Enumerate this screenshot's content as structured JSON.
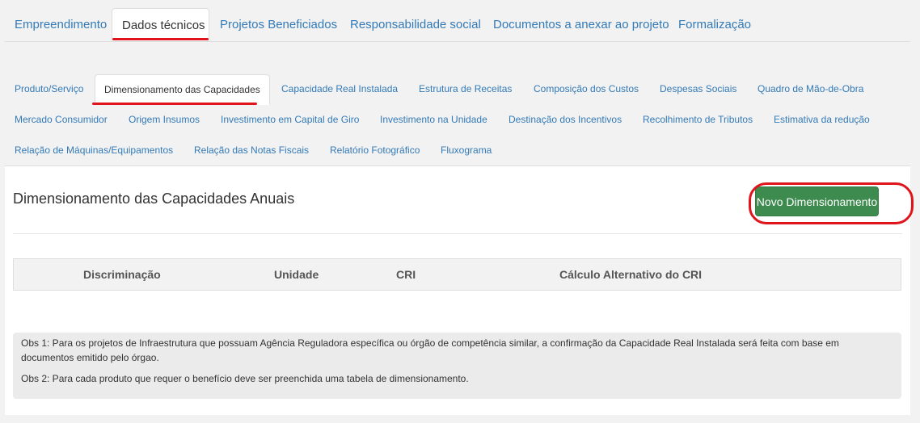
{
  "top_tabs": [
    {
      "label": "Empreendimento"
    },
    {
      "label": "Dados técnicos"
    },
    {
      "label": "Projetos Beneficiados"
    },
    {
      "label": "Responsabilidade social"
    },
    {
      "label": "Documentos a anexar ao projeto"
    },
    {
      "label": "Formalização"
    }
  ],
  "sub_tabs": [
    {
      "label": "Produto/Serviço"
    },
    {
      "label": "Dimensionamento das Capacidades"
    },
    {
      "label": "Capacidade Real Instalada"
    },
    {
      "label": "Estrutura de Receitas"
    },
    {
      "label": "Composição dos Custos"
    },
    {
      "label": "Despesas Sociais"
    },
    {
      "label": "Quadro de Mão-de-Obra"
    },
    {
      "label": "Mercado Consumidor"
    },
    {
      "label": "Origem Insumos"
    },
    {
      "label": "Investimento em Capital de Giro"
    },
    {
      "label": "Investimento na Unidade"
    },
    {
      "label": "Destinação dos Incentivos"
    },
    {
      "label": "Recolhimento de Tributos"
    },
    {
      "label": "Estimativa da redução"
    },
    {
      "label": "Relação de Máquinas/Equipamentos"
    },
    {
      "label": "Relação das Notas Fiscais"
    },
    {
      "label": "Relatório Fotográfico"
    },
    {
      "label": "Fluxograma"
    }
  ],
  "panel": {
    "title": "Dimensionamento das Capacidades Anuais",
    "new_button": "Novo Dimensionamento"
  },
  "table": {
    "columns": [
      "Discriminação",
      "Unidade",
      "CRI",
      "Cálculo Alternativo do CRI"
    ]
  },
  "notes": {
    "obs1": "Obs 1: Para os projetos de Infraestrutura que possuam Agência Reguladora específica ou órgão de competência similar, a confirmação da Capacidade Real Instalada será feita com base em documentos emitido pelo órgao.",
    "obs2": "Obs 2: Para cada produto que requer o benefício deve ser preenchida uma tabela de dimensionamento."
  },
  "colors": {
    "link": "#337ab7",
    "success_button": "#3d8b4f",
    "annotation_red": "#e0141b"
  }
}
